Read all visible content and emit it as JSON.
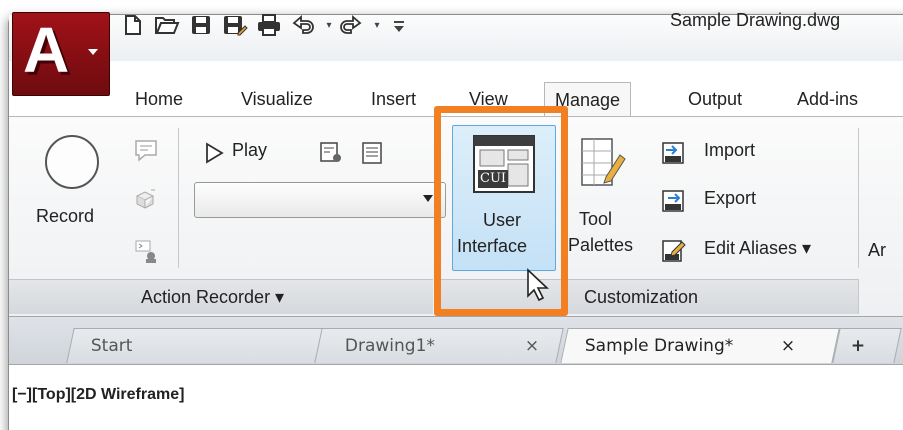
{
  "window": {
    "title": "Sample Drawing.dwg"
  },
  "app_button": {
    "letter": "A",
    "icon": "autocad-logo-icon"
  },
  "quick_access": {
    "icons": [
      "new-icon",
      "open-icon",
      "save-icon",
      "save-as-icon",
      "plot-icon",
      "undo-icon",
      "redo-icon",
      "customize-qat-icon"
    ]
  },
  "ribbon_tabs": [
    "Home",
    "Visualize",
    "Insert",
    "View",
    "Manage",
    "Output",
    "Add-ins"
  ],
  "active_tab": "Manage",
  "action_recorder": {
    "record_label": "Record",
    "play_label": "Play",
    "panel_label": "Action Recorder ▾"
  },
  "customization": {
    "user_interface_line1": "User",
    "user_interface_line2": "Interface",
    "cui_badge": "CUI",
    "tool_line1": "Tool",
    "tool_line2": "Palettes",
    "import_label": "Import",
    "export_label": "Export",
    "edit_aliases_label": "Edit Aliases ▾",
    "panel_label": "Customization",
    "next_panel_partial": "Ar"
  },
  "doc_tabs": {
    "start": "Start",
    "drawing1": "Drawing1*",
    "sample": "Sample Drawing*",
    "close_glyph": "×",
    "add_glyph": "+"
  },
  "viewport": {
    "label": "[−][Top][2D Wireframe]"
  },
  "colors": {
    "highlight": "#f27f22",
    "app_red": "#a01218",
    "selected_blue": "#c4e1f6"
  }
}
